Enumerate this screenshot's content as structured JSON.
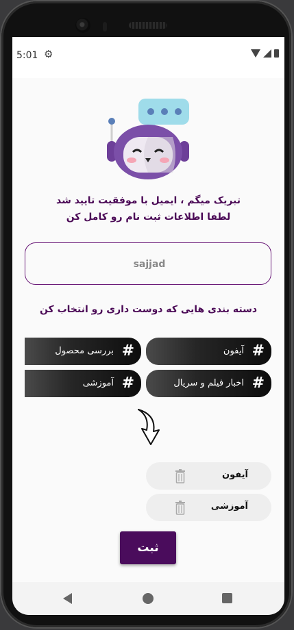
{
  "status": {
    "time": "5:01",
    "icons": [
      "gear-icon",
      "wifi-icon",
      "signal-icon",
      "battery-icon"
    ]
  },
  "header": {
    "line1": "تبریک میگم ، ایمیل با موفقیت تایید شد",
    "line2": "لطفا اطلاعات ثبت نام رو کامل کن"
  },
  "name_field": {
    "value": "sajjad"
  },
  "categories": {
    "title": "دسته بندی هایی که دوست داری رو انتخاب کن",
    "hash": "#",
    "items": [
      {
        "label": "آیفون"
      },
      {
        "label": "بررسی محصول"
      },
      {
        "label": "اخبار فیلم و سریال"
      },
      {
        "label": "آموزشی"
      }
    ]
  },
  "selected": [
    {
      "label": "آیفون"
    },
    {
      "label": "آموزشی"
    }
  ],
  "submit_label": "ثبت",
  "colors": {
    "accent": "#4a0c5c",
    "chip_dark": "#0d0d0d",
    "mascot_purple": "#7b4fa8",
    "bubble": "#9fdcea"
  }
}
